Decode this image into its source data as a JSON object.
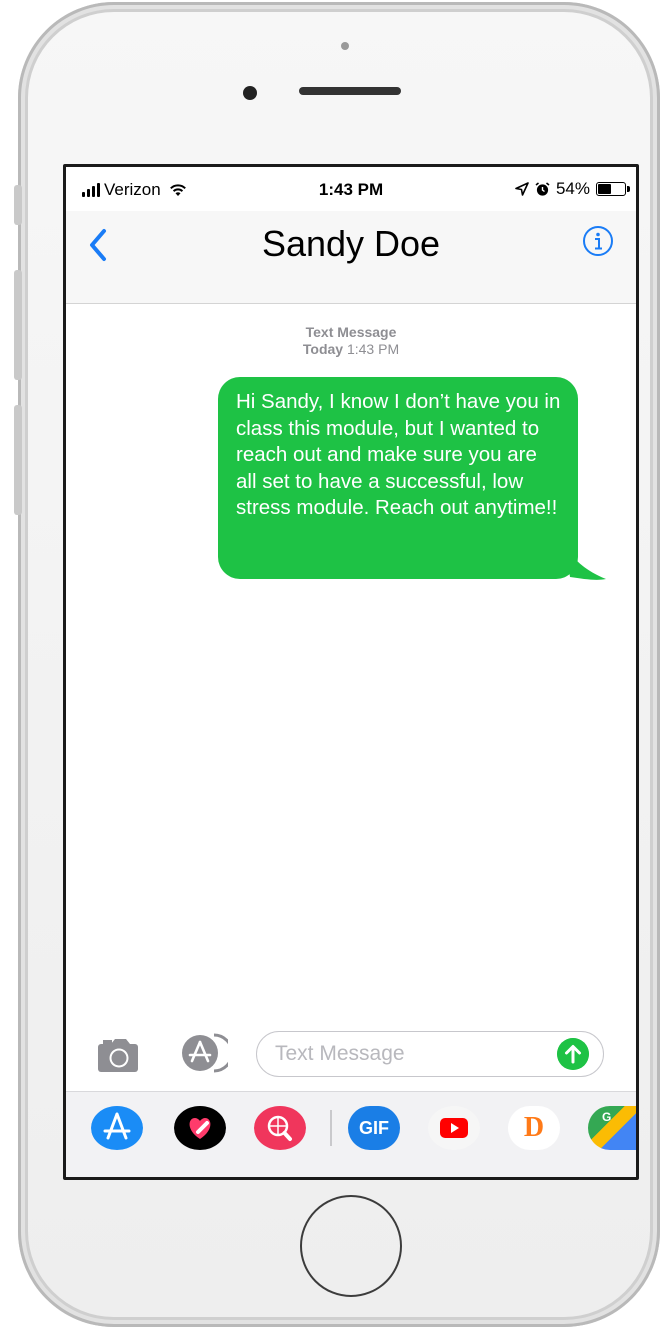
{
  "status_bar": {
    "carrier": "Verizon",
    "time": "1:43 PM",
    "battery": "54%",
    "battery_level": 0.54
  },
  "nav": {
    "contact_name": "Sandy Doe",
    "back_icon": "chevron-left-icon",
    "info_icon": "info-circle-icon"
  },
  "thread": {
    "header_label": "Text Message",
    "date_label": "Today",
    "time_label": "1:43 PM",
    "messages": [
      {
        "direction": "sent",
        "text": "Hi Sandy, I know I don’t have you in class this module, but I wanted to reach out and make sure you are all set to have a successful, low stress module. Reach out anytime!!"
      }
    ]
  },
  "composer": {
    "placeholder": "Text Message",
    "value": "",
    "camera_icon": "camera-icon",
    "apps_icon": "app-store-icon",
    "send_icon": "arrow-up-icon"
  },
  "app_drawer": {
    "apps": [
      {
        "name": "App Store",
        "icon": "app-store-icon",
        "color": "#1a8cf6"
      },
      {
        "name": "Digital Touch",
        "icon": "heart-touch-icon",
        "color": "#000000"
      },
      {
        "name": "Web Images",
        "icon": "globe-search-icon",
        "color": "#f0365c"
      },
      {
        "name": "GIF",
        "icon": "gif-icon",
        "label": "GIF",
        "color": "#1a7ee6"
      },
      {
        "name": "YouTube",
        "icon": "youtube-icon",
        "color": "#ff0000"
      },
      {
        "name": "Dubsmash",
        "icon": "dubsmash-icon",
        "label": "D",
        "color": "#ff8a1e"
      },
      {
        "name": "Google Maps",
        "icon": "google-maps-icon",
        "label": "G",
        "color": "#34a853"
      }
    ]
  },
  "colors": {
    "sent_bubble": "#1ec245",
    "ios_blue": "#1a7cf6",
    "meta_gray": "#8e8e93"
  }
}
